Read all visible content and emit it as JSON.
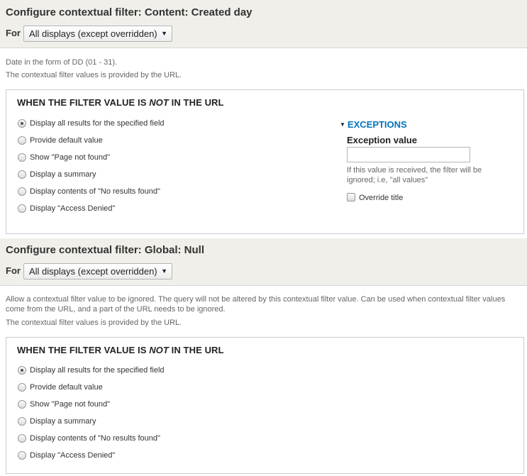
{
  "section1": {
    "title": "Configure contextual filter: Content: Created day",
    "for_label": "For",
    "for_select": "All displays (except overridden)",
    "description_lines": [
      "Date in the form of DD (01 - 31).",
      "The contextual filter values is provided by the URL."
    ],
    "panel": {
      "title_prefix": "WHEN THE FILTER VALUE IS ",
      "title_em": "NOT",
      "title_suffix": " IN THE URL",
      "options": [
        {
          "label": "Display all results for the specified field",
          "checked": true
        },
        {
          "label": "Provide default value",
          "checked": false
        },
        {
          "label": "Show \"Page not found\"",
          "checked": false
        },
        {
          "label": "Display a summary",
          "checked": false
        },
        {
          "label": "Display contents of \"No results found\"",
          "checked": false
        },
        {
          "label": "Display \"Access Denied\"",
          "checked": false
        }
      ],
      "exceptions": {
        "heading": "EXCEPTIONS",
        "value_label": "Exception value",
        "value": "",
        "help_lines": [
          "If this value is received, the filter will be",
          "ignored; i.e, \"all values\""
        ],
        "override_label": "Override title"
      }
    }
  },
  "section2": {
    "title": "Configure contextual filter: Global: Null",
    "for_label": "For",
    "for_select": "All displays (except overridden)",
    "description_lines": [
      "Allow a contextual filter value to be ignored. The query will not be altered by this contextual filter value. Can be used when contextual filter values",
      "come from the URL, and a part of the URL needs to be ignored.",
      "The contextual filter values is provided by the URL."
    ],
    "panel": {
      "title_prefix": "WHEN THE FILTER VALUE IS ",
      "title_em": "NOT",
      "title_suffix": " IN THE URL",
      "options": [
        {
          "label": "Display all results for the specified field",
          "checked": true
        },
        {
          "label": "Provide default value",
          "checked": false
        },
        {
          "label": "Show \"Page not found\"",
          "checked": false
        },
        {
          "label": "Display a summary",
          "checked": false
        },
        {
          "label": "Display contents of \"No results found\"",
          "checked": false
        },
        {
          "label": "Display \"Access Denied\"",
          "checked": false
        }
      ]
    }
  },
  "colors": {
    "header_bg": "#f0efea",
    "link_blue": "#0074bd"
  },
  "icons": {
    "select_arrow": "dropdown-arrow-icon",
    "exceptions_toggle": "triangle-down-icon"
  }
}
